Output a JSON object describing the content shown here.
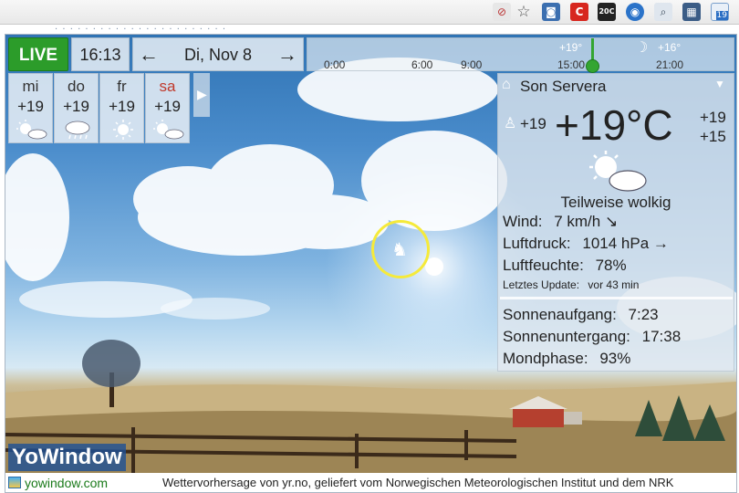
{
  "app": {
    "brand": "YoWindow",
    "footer_link": "yowindow.com",
    "footer_credit": "Wettervorhersage von yr.no, geliefert vom Norwegischen Meteorologischen Institut und dem NRK"
  },
  "browser": {
    "badge_count": "19",
    "icon_20c": "20C",
    "hidden_tab_text": "· · · · · · · · · · · · · · · · · · · · · · ·"
  },
  "top": {
    "live_label": "LIVE",
    "time": "16:13",
    "date": "Di, Nov 8",
    "prev_arrow": "←",
    "next_arrow": "→"
  },
  "timeline": {
    "ticks": [
      "0:00",
      "6:00",
      "9:00",
      "15:00",
      "21:00"
    ],
    "temp_marks": [
      "+19°",
      "+16°"
    ]
  },
  "forecast": [
    {
      "day": "mi",
      "temp": "+19",
      "icon": "sun-cloud-icon"
    },
    {
      "day": "do",
      "temp": "+19",
      "icon": "rain-cloud-icon"
    },
    {
      "day": "fr",
      "temp": "+19",
      "icon": "sun-icon"
    },
    {
      "day": "sa",
      "temp": "+19",
      "icon": "sun-cloud-icon",
      "color": "#c0392b"
    }
  ],
  "current": {
    "location": "Son Servera",
    "feels_like": "+19",
    "temperature": "+19°C",
    "high": "+19",
    "low": "+15",
    "condition": "Teilweise wolkig",
    "wind_label": "Wind:",
    "wind_value": "7 km/h ↘",
    "pressure_label": "Luftdruck:",
    "pressure_value": "1014 hPa →",
    "humidity_label": "Luftfeuchte:",
    "humidity_value": "78%",
    "updated_label": "Letztes Update:",
    "updated_value": "vor 43 min",
    "sunrise_label": "Sonnenaufgang:",
    "sunrise_value": "7:23",
    "sunset_label": "Sonnenuntergang:",
    "sunset_value": "17:38",
    "moon_label": "Mondphase:",
    "moon_value": "93%"
  },
  "colors": {
    "live_green": "#2c9c2a",
    "sky_top": "#2f73b4",
    "weekend_red": "#c0392b"
  }
}
